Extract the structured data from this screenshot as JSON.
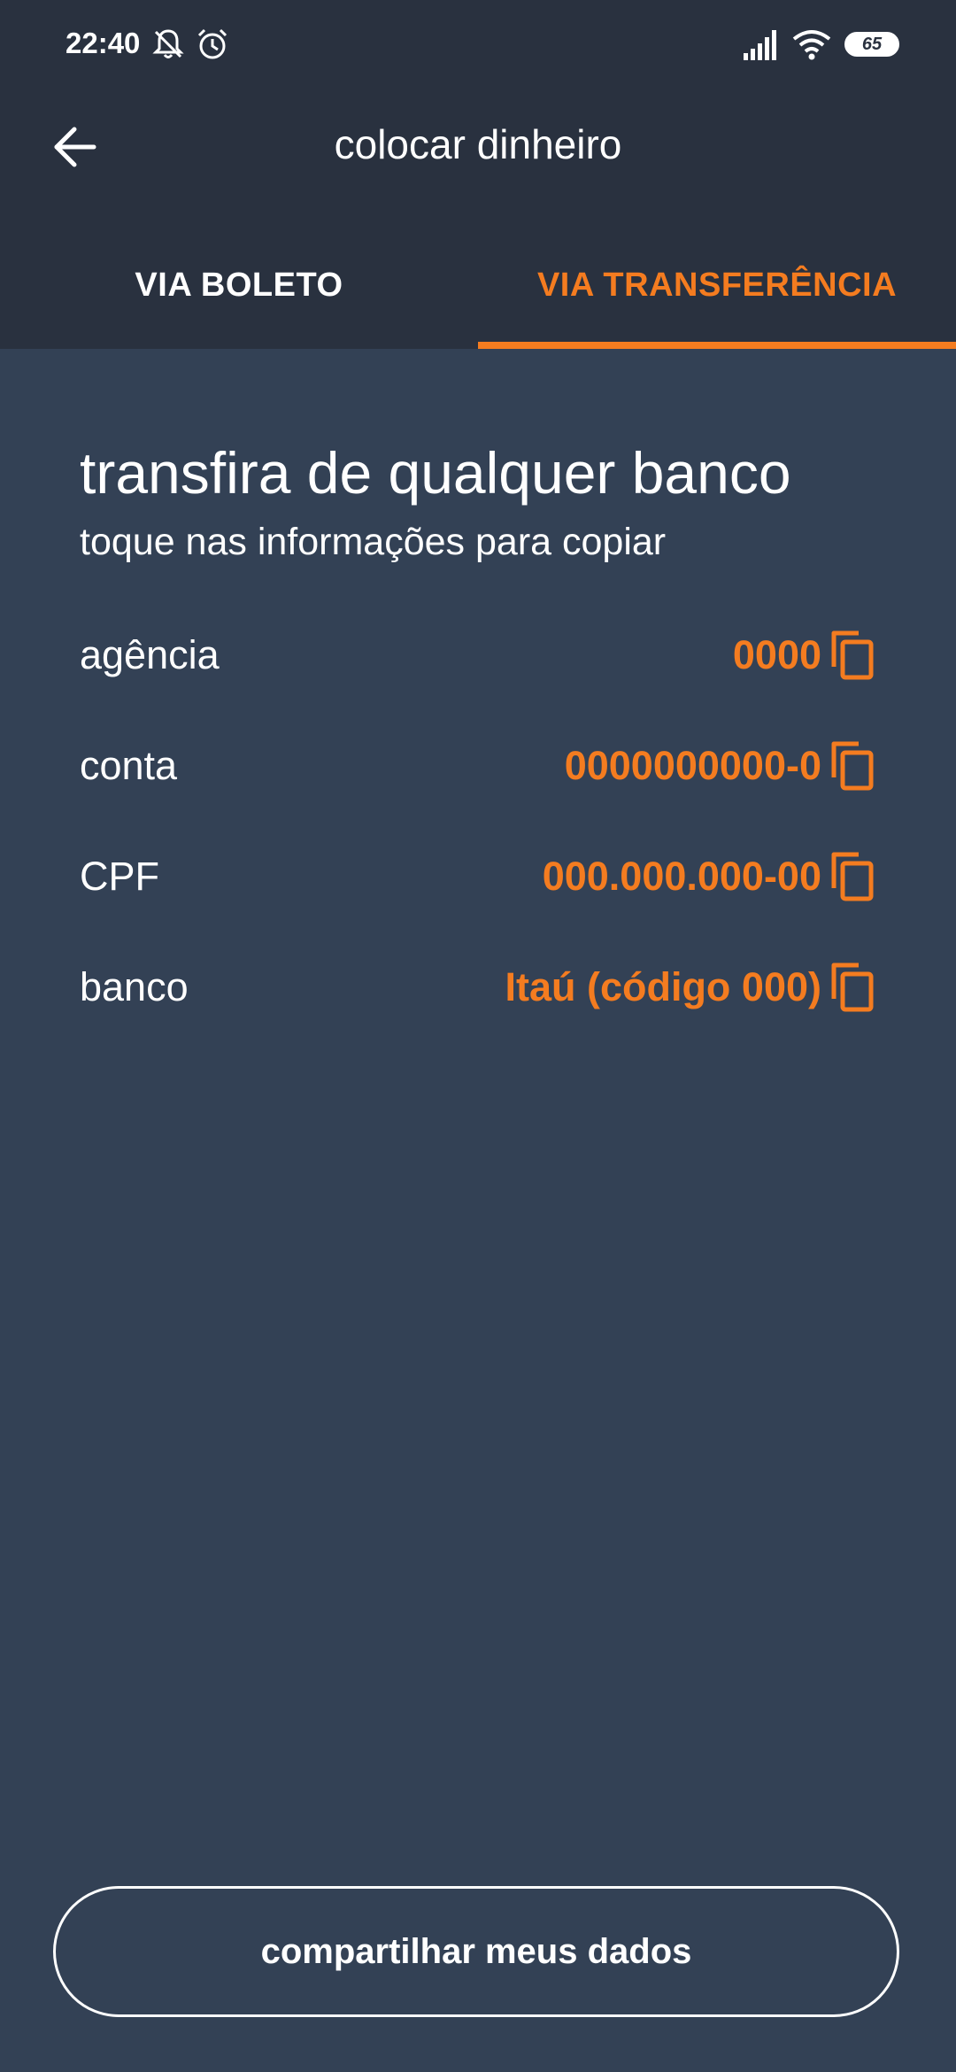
{
  "status_bar": {
    "time": "22:40",
    "battery": "65",
    "icons": [
      "bell-off-icon",
      "alarm-icon",
      "signal-icon",
      "wifi-icon",
      "battery-icon"
    ]
  },
  "header": {
    "title": "colocar dinheiro",
    "back_icon": "arrow-left-icon"
  },
  "tabs": [
    {
      "label": "VIA BOLETO",
      "active": false
    },
    {
      "label": "VIA TRANSFERÊNCIA",
      "active": true
    }
  ],
  "main": {
    "heading": "transfira de qualquer banco",
    "subheading": "toque nas informações para copiar",
    "rows": [
      {
        "label": "agência",
        "value": "0000"
      },
      {
        "label": "conta",
        "value": "0000000000-0"
      },
      {
        "label": "CPF",
        "value": "000.000.000-00"
      },
      {
        "label": "banco",
        "value": "Itaú (código 000)"
      }
    ]
  },
  "footer": {
    "share_label": "compartilhar meus dados"
  },
  "colors": {
    "accent": "#f47c20",
    "background": "#334155",
    "header_background": "#29313f",
    "text": "#ffffff"
  }
}
